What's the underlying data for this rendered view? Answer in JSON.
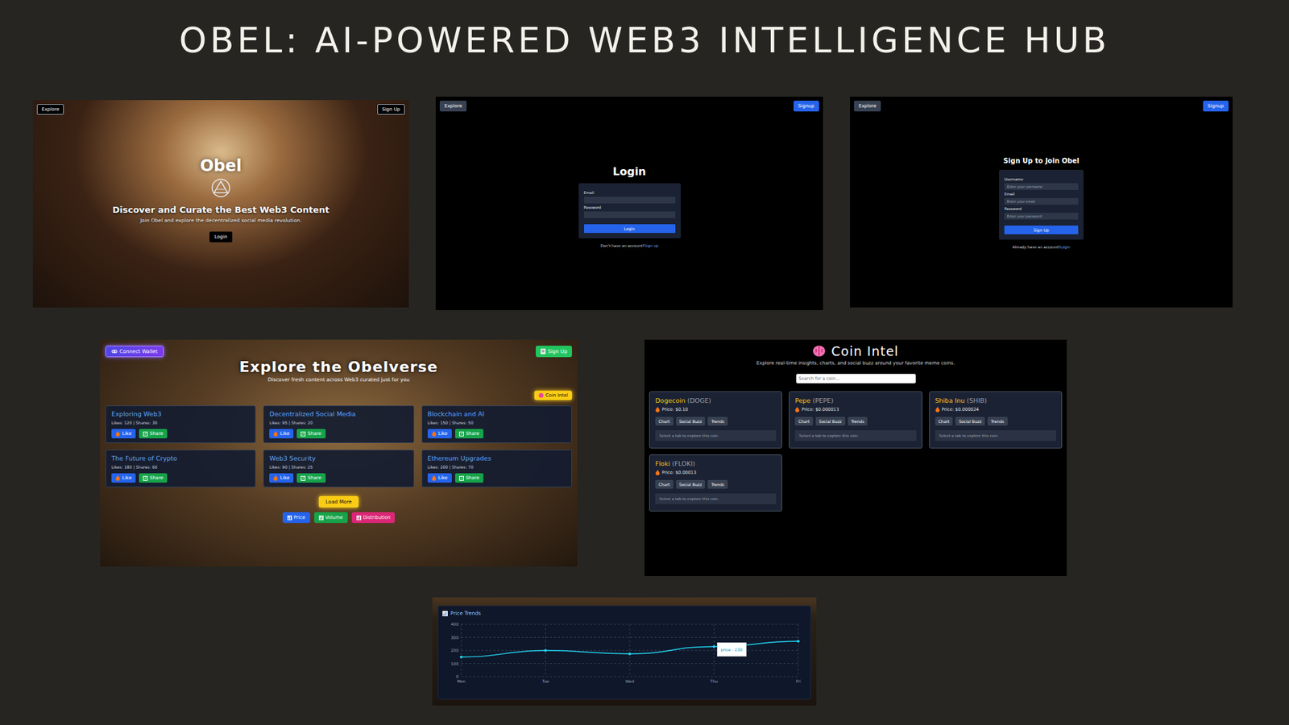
{
  "title": "OBEL: AI-POWERED WEB3 INTELLIGENCE HUB",
  "landing": {
    "nav": {
      "left": "Explore",
      "right": "Sign Up"
    },
    "brand": "Obel",
    "headline": "Discover and Curate the Best Web3 Content",
    "subtitle": "Join Obel and explore the decentralized social media revolution.",
    "button": "Login"
  },
  "login": {
    "nav": {
      "left": "Explore",
      "right": "Signup"
    },
    "heading": "Login",
    "fields": [
      {
        "label": "Email",
        "placeholder": ""
      },
      {
        "label": "Password",
        "placeholder": ""
      }
    ],
    "button": "Login",
    "footer": "Don't have an account?",
    "link": "Sign up"
  },
  "signup": {
    "nav": {
      "left": "Explore",
      "right": "Signup"
    },
    "heading": "Sign Up to Join Obel",
    "fields": [
      {
        "label": "Username",
        "placeholder": "Enter your username"
      },
      {
        "label": "Email",
        "placeholder": "Enter your email"
      },
      {
        "label": "Password",
        "placeholder": "Enter your password"
      }
    ],
    "button": "Sign Up",
    "footer": "Already have an account?",
    "link": "Login"
  },
  "explore": {
    "wallet_button": "Connect Wallet",
    "signup_button": "Sign Up",
    "heading": "Explore the Obelverse",
    "subtitle": "Discover fresh content across Web3 curated just for you",
    "coin_intel_button": "Coin Intel",
    "cards": [
      {
        "title": "Exploring Web3",
        "meta": "Likes: 120 | Shares: 30"
      },
      {
        "title": "Decentralized Social Media",
        "meta": "Likes: 95 | Shares: 20"
      },
      {
        "title": "Blockchain and AI",
        "meta": "Likes: 150 | Shares: 50"
      },
      {
        "title": "The Future of Crypto",
        "meta": "Likes: 180 | Shares: 60"
      },
      {
        "title": "Web3 Security",
        "meta": "Likes: 90 | Shares: 25"
      },
      {
        "title": "Ethereum Upgrades",
        "meta": "Likes: 200 | Shares: 70"
      }
    ],
    "like": "Like",
    "share": "Share",
    "load_more": "Load More",
    "tabs": [
      {
        "label": "Price",
        "color": "#2563eb"
      },
      {
        "label": "Volume",
        "color": "#16a34a"
      },
      {
        "label": "Distribution",
        "color": "#db2777"
      }
    ]
  },
  "coin_intel": {
    "heading": "Coin Intel",
    "subtitle": "Explore real-time insights, charts, and social buzz around your favorite meme coins.",
    "search_placeholder": "Search for a coin...",
    "coins": [
      {
        "name": "Dogecoin",
        "symbol": "(DOGE)",
        "price": "Price: $0.10"
      },
      {
        "name": "Pepe",
        "symbol": "(PEPE)",
        "price": "Price: $0.000013"
      },
      {
        "name": "Shiba Inu",
        "symbol": "(SHIB)",
        "price": "Price: $0.000024"
      },
      {
        "name": "Floki",
        "symbol": "(FLOKI)",
        "price": "Price: $0.00013"
      }
    ],
    "coin_tabs": [
      "Chart",
      "Social Buzz",
      "Trends"
    ],
    "coin_hint": "Select a tab to explore this coin."
  },
  "chart": {
    "title": "Price Trends",
    "y_ticks": [
      "0",
      "100",
      "200",
      "300",
      "400"
    ],
    "x_ticks": [
      "Mon",
      "Tue",
      "Wed",
      "Thu",
      "Fri"
    ],
    "series": [
      {
        "name": "price",
        "values": [
          150,
          200,
          175,
          230,
          270
        ]
      }
    ],
    "tooltip": {
      "text": "price : 230",
      "index": 3
    }
  }
}
